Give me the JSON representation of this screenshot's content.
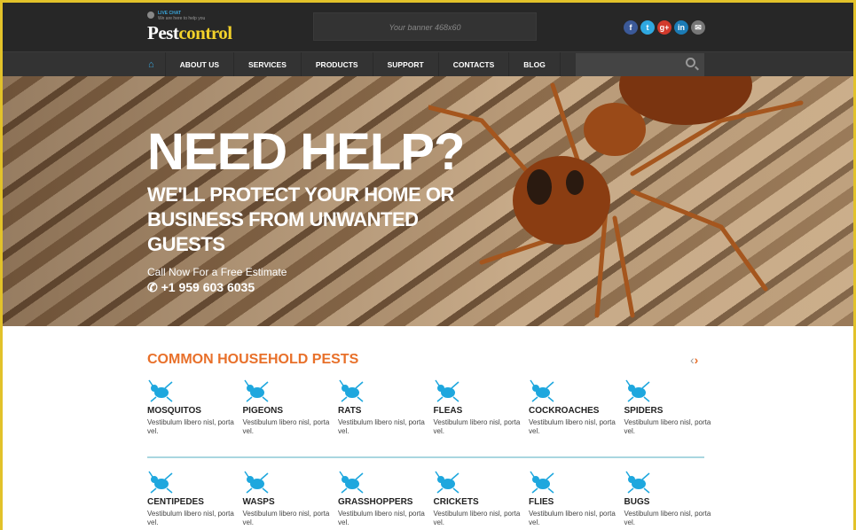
{
  "header": {
    "live_chat": "LIVE CHAT",
    "live_sub": "We are here to help you",
    "logo_a": "Pest",
    "logo_b": "control",
    "banner": "Your banner 468x60",
    "social": [
      {
        "icon": "facebook-icon",
        "glyph": "f",
        "color": "#3b5998"
      },
      {
        "icon": "twitter-icon",
        "glyph": "t",
        "color": "#2fa8e0"
      },
      {
        "icon": "google-plus-icon",
        "glyph": "g+",
        "color": "#d23a2c"
      },
      {
        "icon": "linkedin-icon",
        "glyph": "in",
        "color": "#1b7bb5"
      },
      {
        "icon": "email-icon",
        "glyph": "✉",
        "color": "#777"
      }
    ]
  },
  "nav": {
    "items": [
      "ABOUT US",
      "SERVICES",
      "PRODUCTS",
      "SUPPORT",
      "CONTACTS",
      "BLOG"
    ]
  },
  "hero": {
    "title": "NEED HELP?",
    "subtitle": "WE'LL PROTECT YOUR HOME OR BUSINESS FROM UNWANTED GUESTS",
    "cta": "Call Now For a Free Estimate",
    "phone": "+1 959 603 6035"
  },
  "pests": {
    "title": "COMMON HOUSEHOLD PESTS",
    "accent": "#1ea7de",
    "items": [
      {
        "name": "MOSQUITOS",
        "desc": "Vestibulum libero nisl, porta vel."
      },
      {
        "name": "PIGEONS",
        "desc": "Vestibulum libero nisl, porta vel."
      },
      {
        "name": "RATS",
        "desc": "Vestibulum libero nisl, porta vel."
      },
      {
        "name": "FLEAS",
        "desc": "Vestibulum libero nisl, porta vel."
      },
      {
        "name": "COCKROACHES",
        "desc": "Vestibulum libero nisl, porta vel."
      },
      {
        "name": "SPIDERS",
        "desc": "Vestibulum libero nisl, porta vel."
      },
      {
        "name": "CENTIPEDES",
        "desc": "Vestibulum libero nisl, porta vel."
      },
      {
        "name": "WASPS",
        "desc": "Vestibulum libero nisl, porta vel."
      },
      {
        "name": "GRASSHOPPERS",
        "desc": "Vestibulum libero nisl, porta vel."
      },
      {
        "name": "CRICKETS",
        "desc": "Vestibulum libero nisl, porta vel."
      },
      {
        "name": "FLIES",
        "desc": "Vestibulum libero nisl, porta vel."
      },
      {
        "name": "BUGS",
        "desc": "Vestibulum libero nisl, porta vel."
      }
    ]
  }
}
